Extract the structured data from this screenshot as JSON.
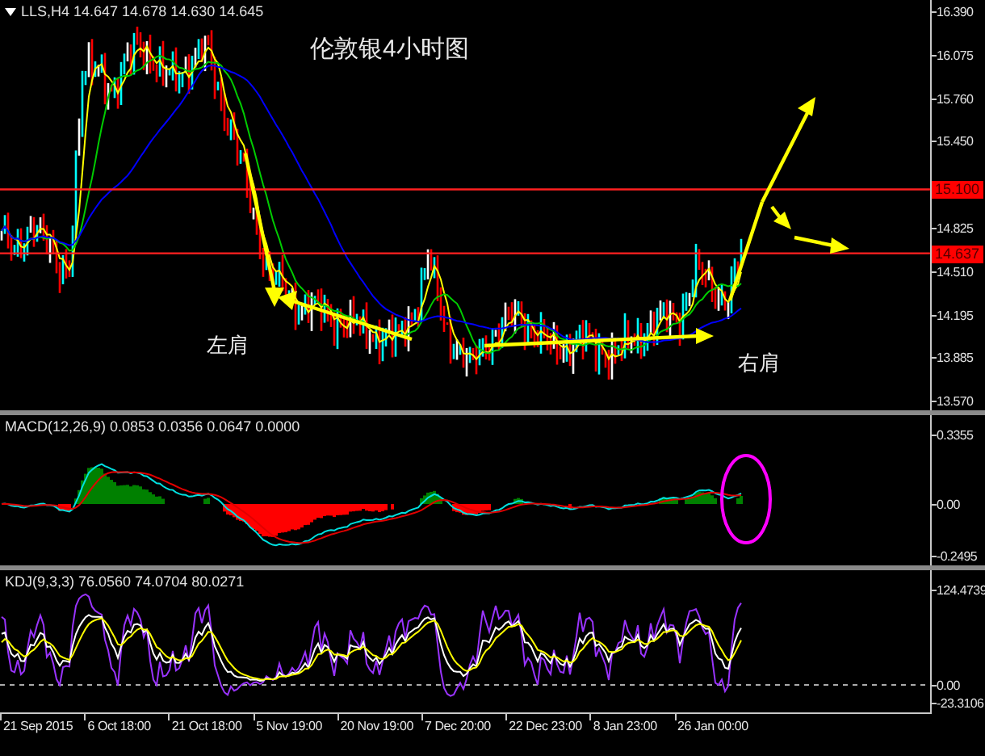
{
  "main_chart": {
    "symbol_info": "LLS,H4  14.647 14.678 14.630 14.645",
    "title": "伦敦银4小时图",
    "shoulder_labels": [
      "左肩",
      "右肩"
    ],
    "price_ticks": [
      "16.390",
      "16.075",
      "15.760",
      "15.450",
      "14.825",
      "14.510",
      "14.195",
      "13.885",
      "13.570"
    ],
    "price_tags": [
      "15.100",
      "14.637"
    ]
  },
  "macd_panel": {
    "info": "MACD(12,26,9) 0.0853 0.0356 0.0647 0.0000",
    "ticks": [
      "0.3355",
      "0.00",
      "-0.2495"
    ]
  },
  "kdj_panel": {
    "info": "KDJ(9,3,3) 76.0560 74.0704 80.0271",
    "ticks": [
      "124.4739",
      "0.00",
      "-23.3106"
    ]
  },
  "time_axis": [
    "21 Sep 2015",
    "6 Oct 18:00",
    "21 Oct 18:00",
    "5 Nov 19:00",
    "20 Nov 19:00",
    "7 Dec 20:00",
    "22 Dec 23:00",
    "8 Jan 23:00",
    "26 Jan 00:00"
  ]
}
